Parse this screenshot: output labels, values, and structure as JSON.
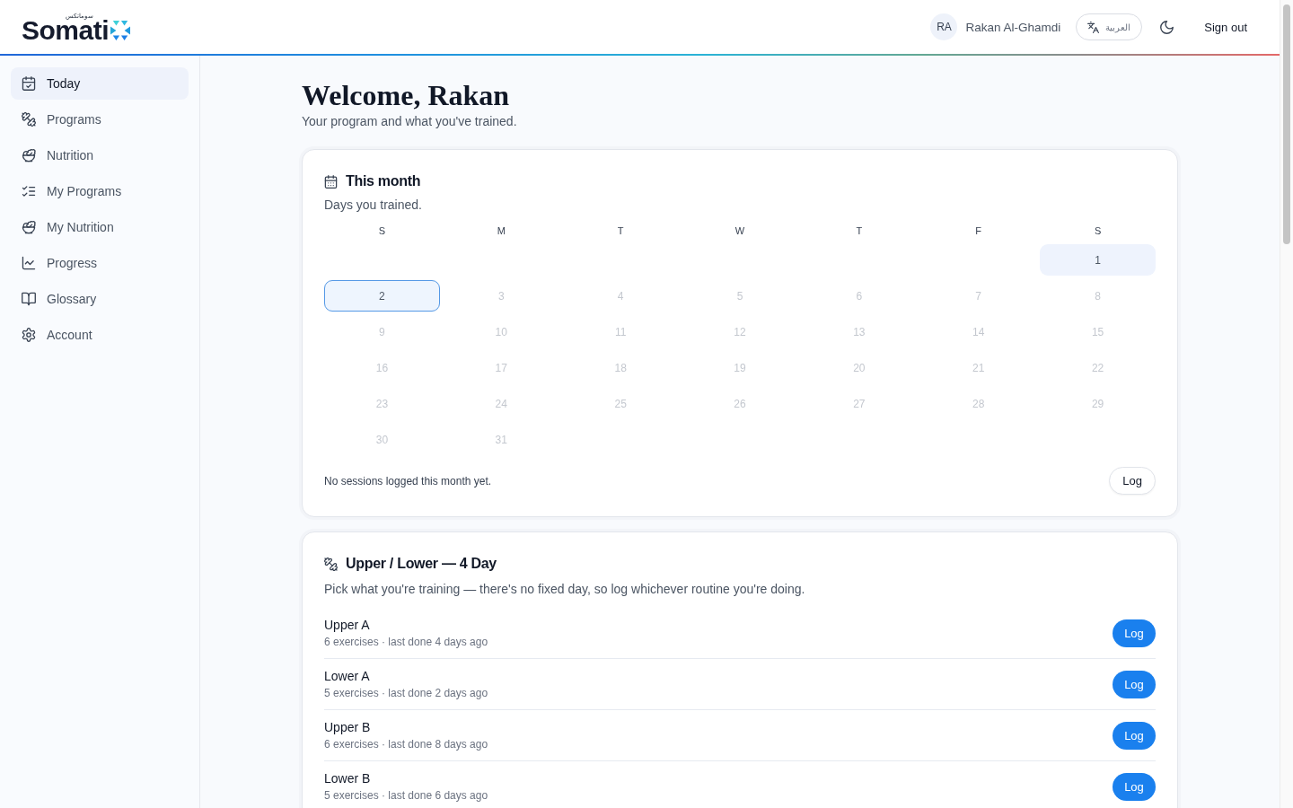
{
  "header": {
    "logo": {
      "wordmark": "Somati",
      "tagline": "سوماتكس"
    },
    "user": {
      "initials": "RA",
      "name": "Rakan Al-Ghamdi"
    },
    "language_button": "العربية",
    "sign_out": "Sign out"
  },
  "sidebar": {
    "items": [
      {
        "label": "Today",
        "selected": true
      },
      {
        "label": "Programs",
        "selected": false
      },
      {
        "label": "Nutrition",
        "selected": false
      },
      {
        "label": "My Programs",
        "selected": false
      },
      {
        "label": "My Nutrition",
        "selected": false
      },
      {
        "label": "Progress",
        "selected": false
      },
      {
        "label": "Glossary",
        "selected": false
      },
      {
        "label": "Account",
        "selected": false
      }
    ]
  },
  "page": {
    "title": "Welcome, Rakan",
    "subtitle": "Your program and what you've trained."
  },
  "calendar_card": {
    "title": "This month",
    "subtitle": "Days you trained.",
    "weekdays": [
      "S",
      "M",
      "T",
      "W",
      "T",
      "F",
      "S"
    ],
    "weeks": [
      [
        {
          "day": "1",
          "disabled": false,
          "today": false
        }
      ],
      [
        {
          "day": "2",
          "disabled": false,
          "today": true
        },
        {
          "day": "3",
          "disabled": true,
          "today": false
        },
        {
          "day": "4",
          "disabled": true,
          "today": false
        },
        {
          "day": "5",
          "disabled": true,
          "today": false
        },
        {
          "day": "6",
          "disabled": true,
          "today": false
        },
        {
          "day": "7",
          "disabled": true,
          "today": false
        },
        {
          "day": "8",
          "disabled": true,
          "today": false
        }
      ],
      [
        {
          "day": "9",
          "disabled": true,
          "today": false
        },
        {
          "day": "10",
          "disabled": true,
          "today": false
        },
        {
          "day": "11",
          "disabled": true,
          "today": false
        },
        {
          "day": "12",
          "disabled": true,
          "today": false
        },
        {
          "day": "13",
          "disabled": true,
          "today": false
        },
        {
          "day": "14",
          "disabled": true,
          "today": false
        },
        {
          "day": "15",
          "disabled": true,
          "today": false
        }
      ],
      [
        {
          "day": "16",
          "disabled": true,
          "today": false
        },
        {
          "day": "17",
          "disabled": true,
          "today": false
        },
        {
          "day": "18",
          "disabled": true,
          "today": false
        },
        {
          "day": "19",
          "disabled": true,
          "today": false
        },
        {
          "day": "20",
          "disabled": true,
          "today": false
        },
        {
          "day": "21",
          "disabled": true,
          "today": false
        },
        {
          "day": "22",
          "disabled": true,
          "today": false
        }
      ],
      [
        {
          "day": "23",
          "disabled": true,
          "today": false
        },
        {
          "day": "24",
          "disabled": true,
          "today": false
        },
        {
          "day": "25",
          "disabled": true,
          "today": false
        },
        {
          "day": "26",
          "disabled": true,
          "today": false
        },
        {
          "day": "27",
          "disabled": true,
          "today": false
        },
        {
          "day": "28",
          "disabled": true,
          "today": false
        },
        {
          "day": "29",
          "disabled": true,
          "today": false
        }
      ],
      [
        {
          "day": "30",
          "disabled": true,
          "today": false
        },
        {
          "day": "31",
          "disabled": true,
          "today": false
        }
      ]
    ],
    "empty_message": "No sessions logged this month yet.",
    "log_button": "Log"
  },
  "program_card": {
    "title": "Upper / Lower — 4 Day",
    "description": "Pick what you're training — there's no fixed day, so log whichever routine you're doing.",
    "routines": [
      {
        "name": "Upper A",
        "details": "6 exercises · last done 4 days ago",
        "button": "Log"
      },
      {
        "name": "Lower A",
        "details": "5 exercises · last done 2 days ago",
        "button": "Log"
      },
      {
        "name": "Upper B",
        "details": "6 exercises · last done 8 days ago",
        "button": "Log"
      },
      {
        "name": "Lower B",
        "details": "5 exercises · last done 6 days ago",
        "button": "Log"
      }
    ]
  }
}
